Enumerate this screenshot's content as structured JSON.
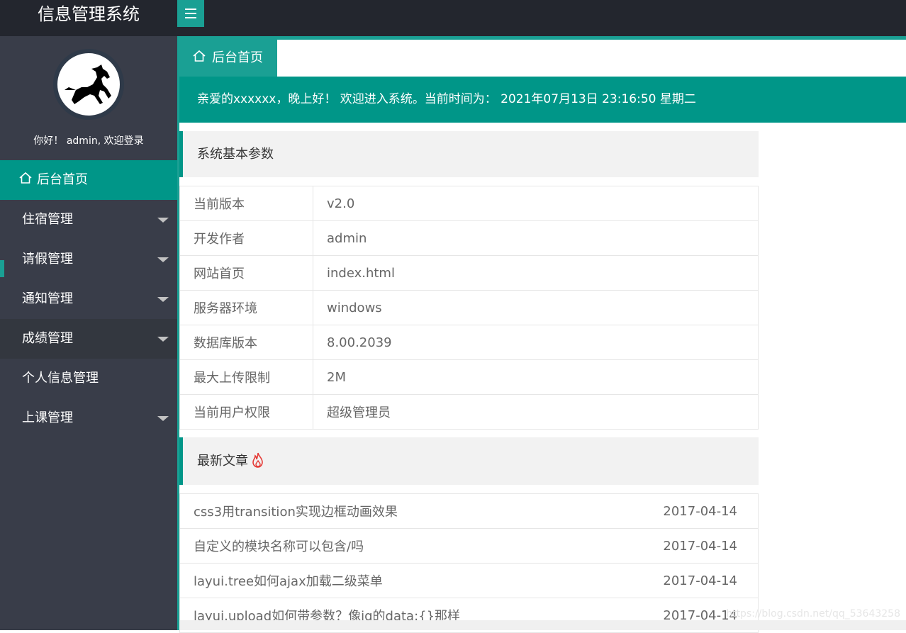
{
  "app": {
    "title": "信息管理系统"
  },
  "user": {
    "welcome": "你好！ admin, 欢迎登录"
  },
  "sidebar": {
    "items": [
      {
        "label": "后台首页",
        "active": true,
        "has_arrow": false
      },
      {
        "label": "住宿管理",
        "has_arrow": true
      },
      {
        "label": "请假管理",
        "has_arrow": true
      },
      {
        "label": "通知管理",
        "has_arrow": true
      },
      {
        "label": "成绩管理",
        "has_arrow": true
      },
      {
        "label": "个人信息管理",
        "has_arrow": false
      },
      {
        "label": "上课管理",
        "has_arrow": true
      }
    ]
  },
  "tabs": [
    {
      "label": "后台首页",
      "icon": "home-icon"
    }
  ],
  "greeting": "亲爱的xxxxxx，晚上好！ 欢迎进入系统。当前时间为： 2021年07月13日 23:16:50    星期二",
  "system_params": {
    "title": "系统基本参数",
    "rows": [
      {
        "key": "当前版本",
        "value": "v2.0"
      },
      {
        "key": "开发作者",
        "value": "admin"
      },
      {
        "key": "网站首页",
        "value": "index.html"
      },
      {
        "key": "服务器环境",
        "value": "windows"
      },
      {
        "key": "数据库版本",
        "value": "8.00.2039"
      },
      {
        "key": "最大上传限制",
        "value": "2M"
      },
      {
        "key": "当前用户权限",
        "value": "超级管理员"
      }
    ]
  },
  "articles": {
    "title": "最新文章",
    "icon": "fire-icon",
    "rows": [
      {
        "title": "css3用transition实现边框动画效果",
        "date": "2017-04-14"
      },
      {
        "title": "自定义的模块名称可以包含/吗",
        "date": "2017-04-14"
      },
      {
        "title": "layui.tree如何ajax加载二级菜单",
        "date": "2017-04-14"
      },
      {
        "title": "layui.upload如何带参数？像jq的data:{}那样",
        "date": "2017-04-14"
      }
    ]
  },
  "watermark": "https://blog.csdn.net/qq_53643258",
  "colors": {
    "header_bg": "#23262e",
    "sidebar_bg": "#393d49",
    "accent": "#009688",
    "accent_light": "#1aa094"
  }
}
